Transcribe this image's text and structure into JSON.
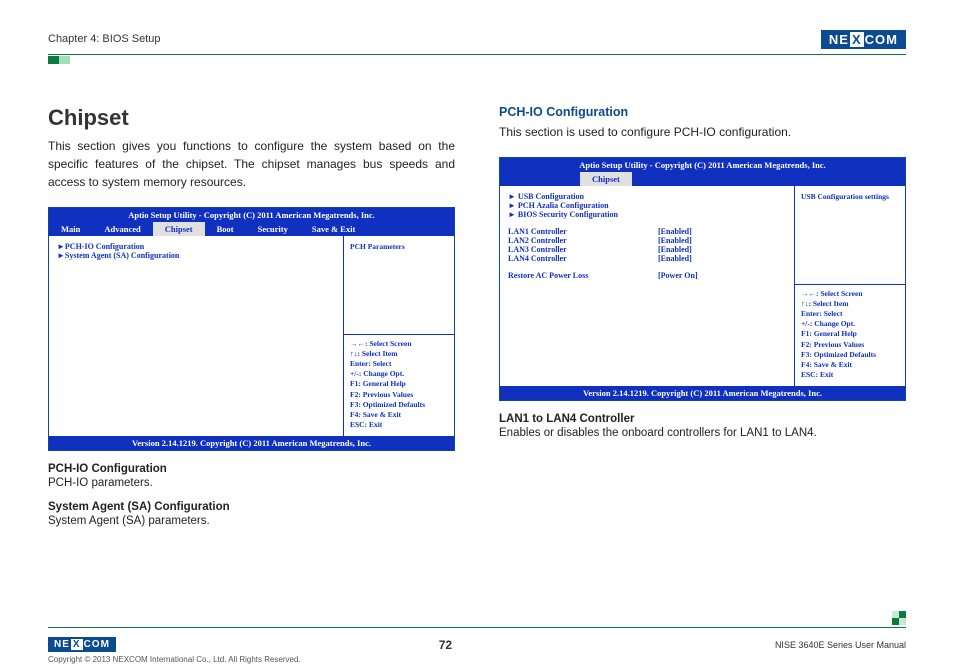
{
  "header": {
    "chapter": "Chapter 4: BIOS Setup",
    "brand_left": "NE",
    "brand_x": "X",
    "brand_right": "COM"
  },
  "left": {
    "title": "Chipset",
    "intro": "This section gives you functions to configure the system based on the specific features of the chipset. The chipset manages bus speeds and access to system memory resources.",
    "bios": {
      "title": "Aptio Setup Utility - Copyright (C) 2011 American Megatrends, Inc.",
      "tabs": [
        "Main",
        "Advanced",
        "Chipset",
        "Boot",
        "Security",
        "Save & Exit"
      ],
      "active_tab": "Chipset",
      "items": [
        "PCH-IO Configuration",
        "System Agent (SA) Configuration"
      ],
      "side_hint": "PCH Parameters",
      "legend": [
        "→←: Select Screen",
        "↑↓: Select Item",
        "Enter: Select",
        "+/-: Change Opt.",
        "F1: General Help",
        "F2: Previous Values",
        "F3: Optimized Defaults",
        "F4: Save & Exit",
        "ESC: Exit"
      ],
      "footer": "Version 2.14.1219. Copyright (C) 2011 American Megatrends, Inc."
    },
    "defs": [
      {
        "h": "PCH-IO Configuration",
        "d": "PCH-IO parameters."
      },
      {
        "h": "System Agent (SA) Configuration",
        "d": "System Agent (SA) parameters."
      }
    ]
  },
  "right": {
    "title": "PCH-IO Configuration",
    "intro": "This section is used to configure PCH-IO configuration.",
    "bios": {
      "title": "Aptio Setup Utility - Copyright (C) 2011 American Megatrends, Inc.",
      "active_tab": "Chipset",
      "submenus": [
        "USB Configuration",
        "PCH Azalia Configuration",
        "BIOS Security Configuration"
      ],
      "rows": [
        {
          "k": "LAN1 Controller",
          "v": "[Enabled]"
        },
        {
          "k": "LAN2 Controller",
          "v": "[Enabled]"
        },
        {
          "k": "LAN3 Controller",
          "v": "[Enabled]"
        },
        {
          "k": "LAN4 Controller",
          "v": "[Enabled]"
        }
      ],
      "extra": {
        "k": "Restore AC Power Loss",
        "v": "[Power On]"
      },
      "side_hint": "USB Configuration settings",
      "legend": [
        "→←: Select Screen",
        "↑↓: Select Item",
        "Enter: Select",
        "+/-: Change Opt.",
        "F1: General Help",
        "F2: Previous Values",
        "F3: Optimized Defaults",
        "F4: Save & Exit",
        "ESC: Exit"
      ],
      "footer": "Version 2.14.1219. Copyright (C) 2011 American Megatrends, Inc."
    },
    "defs": [
      {
        "h": "LAN1 to LAN4 Controller",
        "d": "Enables or disables the onboard controllers for LAN1 to LAN4."
      }
    ]
  },
  "footer": {
    "copyright": "Copyright © 2013 NEXCOM International Co., Ltd. All Rights Reserved.",
    "page": "72",
    "doc": "NISE 3640E Series User Manual"
  }
}
